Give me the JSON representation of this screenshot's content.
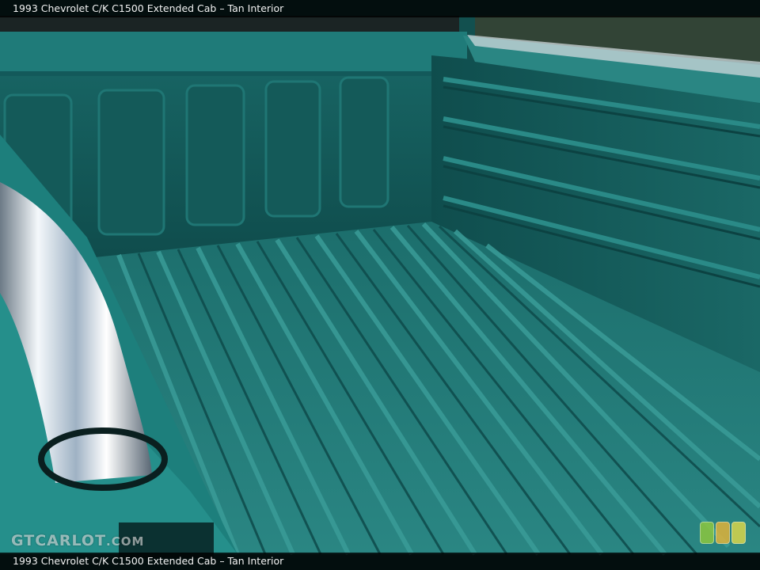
{
  "caption": {
    "top": "1993 Chevrolet C/K C1500 Extended Cab – Tan Interior",
    "bottom": "1993 Chevrolet C/K C1500 Extended Cab – Tan Interior"
  },
  "watermark": {
    "main": "GTCARLOT",
    "suffix": ".COM"
  },
  "colors": {
    "bed_paint": "#1d7a78",
    "bed_shadow": "#0f4f4f",
    "chrome": "#dfe7ee",
    "swatch_green": "#8cc63f",
    "swatch_amber": "#e0b23a",
    "swatch_yellow": "#d9d64a"
  },
  "icons": [
    "gtcarlot-logo",
    "color-swatch-green",
    "color-swatch-amber",
    "color-swatch-yellow"
  ]
}
